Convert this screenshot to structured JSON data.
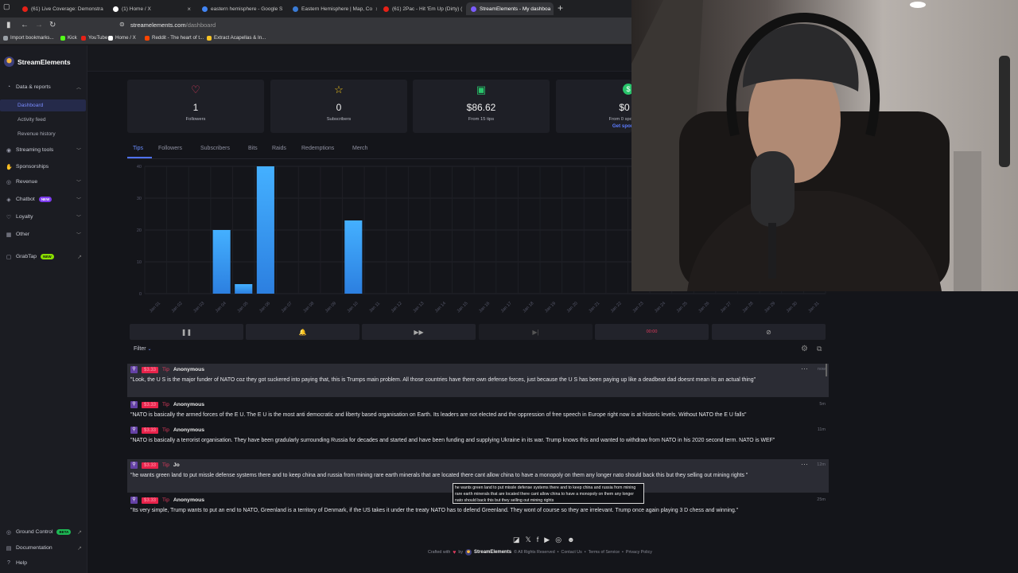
{
  "browser": {
    "tabs": [
      {
        "label": "(61) Live Coverage: Demonstra",
        "color": "#e62117"
      },
      {
        "label": "(1) Home / X",
        "color": "#ffffff"
      },
      {
        "label": "eastern hemisphere - Google S",
        "color": "#4285f4"
      },
      {
        "label": "Eastern Hemisphere | Map, Co",
        "color": "#3a7bd5"
      },
      {
        "label": "(61) 2Pac - Hit 'Em Up (Dirty) (",
        "color": "#e62117"
      },
      {
        "label": "StreamElements - My dashboa",
        "color": "#7b5cff"
      }
    ],
    "url_host": "streamelements.com",
    "url_path": "/dashboard",
    "bookmarks": [
      {
        "label": "Import bookmarks...",
        "color": "#9aa0a6"
      },
      {
        "label": "Kick",
        "color": "#53fc18"
      },
      {
        "label": "YouTube",
        "color": "#e62117"
      },
      {
        "label": "Home / X",
        "color": "#ffffff"
      },
      {
        "label": "Reddit - The heart of t...",
        "color": "#ff4500"
      },
      {
        "label": "Extract Acapellas & In...",
        "color": "#f7c325"
      }
    ]
  },
  "sidebar": {
    "brand": "StreamElements",
    "items": [
      {
        "label": "Data & reports",
        "icon": "chart-pie-icon",
        "chev": "^"
      },
      {
        "label": "Dashboard",
        "sub": true,
        "active": true
      },
      {
        "label": "Activity feed",
        "sub": true
      },
      {
        "label": "Revenue history",
        "sub": true
      },
      {
        "label": "Streaming tools",
        "icon": "broadcast-icon",
        "chev": "v"
      },
      {
        "label": "Sponsorships",
        "icon": "handshake-icon"
      },
      {
        "label": "Revenue",
        "icon": "coins-icon",
        "chev": "v"
      },
      {
        "label": "Chatbot",
        "icon": "robot-icon",
        "chev": "v",
        "badge": "NEW"
      },
      {
        "label": "Loyalty",
        "icon": "heart-icon",
        "chev": "v"
      },
      {
        "label": "Other",
        "icon": "grid-icon",
        "chev": "v"
      },
      {
        "label": "GrabTap",
        "icon": "tap-icon",
        "badge": "NEW",
        "badge_style": "lime",
        "external": true
      }
    ],
    "bottom": [
      {
        "label": "Ground Control",
        "badge": "BETA"
      },
      {
        "label": "Documentation"
      },
      {
        "label": "Help"
      }
    ]
  },
  "stats": [
    {
      "icon": "heart-outline-icon",
      "value": "1",
      "label": "Followers",
      "color": "#e23b5e"
    },
    {
      "icon": "star-outline-icon",
      "value": "0",
      "label": "Subscribers",
      "color": "#f5c518"
    },
    {
      "icon": "money-icon",
      "value": "$86.62",
      "label": "From 15 tips",
      "color": "#29c46b"
    },
    {
      "icon": "dollar-circle-icon",
      "value": "$0",
      "label": "From 0 sponso",
      "link": "Get spons",
      "color": "#29c46b"
    }
  ],
  "chart_tabs": [
    "Tips",
    "Followers",
    "Subscribers",
    "Bits",
    "Raids",
    "Redemptions",
    "Merch"
  ],
  "chart_data": {
    "type": "bar",
    "categories": [
      "Jan 01",
      "Jan 02",
      "Jan 03",
      "Jan 04",
      "Jan 05",
      "Jan 06",
      "Jan 07",
      "Jan 08",
      "Jan 09",
      "Jan 10",
      "Jan 11",
      "Jan 12",
      "Jan 13",
      "Jan 14",
      "Jan 15",
      "Jan 16",
      "Jan 17",
      "Jan 18",
      "Jan 19",
      "Jan 20",
      "Jan 21",
      "Jan 22",
      "Jan 23",
      "Jan 24",
      "Jan 25",
      "Jan 26",
      "Jan 27",
      "Jan 28",
      "Jan 29",
      "Jan 30",
      "Jan 31"
    ],
    "values": [
      0,
      0,
      0,
      20,
      3,
      40,
      0,
      0,
      0,
      23,
      0,
      0,
      0,
      0,
      0,
      0,
      0,
      0,
      0,
      0,
      0,
      0,
      0,
      0,
      0,
      0,
      0,
      0,
      0,
      0,
      0
    ],
    "ylim": [
      0,
      40
    ],
    "yticks": [
      0,
      10,
      20,
      30,
      40
    ],
    "grid": true,
    "bar_color": "#3fa3f0"
  },
  "controls": [
    {
      "icon": "pause-icon",
      "glyph": "❚❚"
    },
    {
      "icon": "bell-icon",
      "glyph": "🔔"
    },
    {
      "icon": "fast-forward-icon",
      "glyph": "▶▶"
    },
    {
      "icon": "skip-icon",
      "glyph": "▶|"
    },
    {
      "icon": "record-icon",
      "glyph": "00:00"
    },
    {
      "icon": "clear-icon",
      "glyph": "⊘"
    }
  ],
  "filter_label": "Filter",
  "feed": [
    {
      "amount": "$3.33",
      "kind": "Tip",
      "name": "Anonymous",
      "time": "now",
      "highlight": true,
      "dots": true,
      "message": "\"Look, the U S is the major funder of NATO coz they got suckered into paying that, this is Trumps main problem. All those countries have there own defense forces, just because the U S has been paying up like a deadbeat dad doesnt mean its an actual thing\""
    },
    {
      "amount": "$3.33",
      "kind": "Tip",
      "name": "Anonymous",
      "time": "5m",
      "highlight": false,
      "message": "\"NATO is basically the armed forces of the E U. The E U is the most anti democratic and liberty based organisation on Earth. Its leaders are not elected and the oppression of free speech in Europe right now is at historic levels. Without NATO the E U falls\""
    },
    {
      "amount": "$3.33",
      "kind": "Tip",
      "name": "Anonymous",
      "time": "11m",
      "highlight": false,
      "message": "\"NATO is basically a terrorist organisation. They have been gradularly surrounding Russia for decades and started and have been funding and supplying Ukraine in its war. Trump knows this and wanted to withdraw from NATO in his 2020 second term. NATO is WEF\""
    },
    {
      "amount": "$3.33",
      "kind": "Tip",
      "name": "Jo",
      "time": "12m",
      "highlight": true,
      "dots": true,
      "message": "\"he wants green land to put missle defense systems there and to keep china and russia from mining rare earth minerals that are located there cant allow china to have a monopoly on them any longer nato should back this but they selling out mining rights \""
    },
    {
      "amount": "$3.33",
      "kind": "Tip",
      "name": "Anonymous",
      "time": "25m",
      "highlight": false,
      "message": "\"Its very simple, Trump wants to put an end to NATO, Greenland is a territory of Denmark, if the US takes it under the treaty NATO has to defend Greenland. They wont of course so they are irrelevant. Trump once again playing 3 D chess and winning.\""
    }
  ],
  "tooltip": "he wants green land to put missle defense systems there and to keep china and russia from mining rare earth minerals that are located there cant allow china to have a monopoly on them any longer nato should back this but they selling out mining rights",
  "footer": {
    "crafted": "Crafted with",
    "by": "by",
    "brand": "StreamElements",
    "rights": "© All Rights Reserved",
    "links": [
      "Contact Us",
      "Terms of Service",
      "Privacy Policy"
    ]
  }
}
